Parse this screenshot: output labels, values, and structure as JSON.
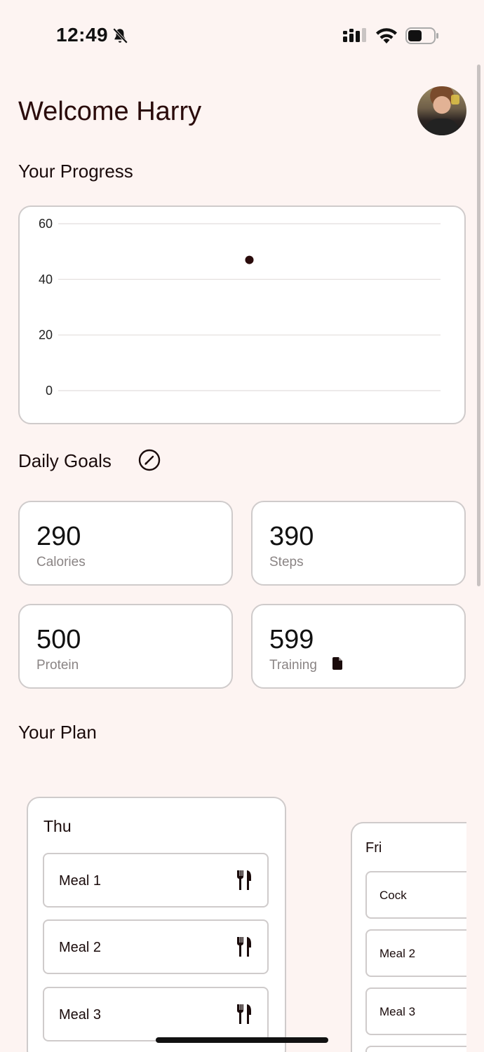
{
  "status_bar": {
    "time": "12:49"
  },
  "header": {
    "welcome": "Welcome Harry"
  },
  "progress": {
    "title": "Your Progress"
  },
  "chart_data": {
    "type": "scatter",
    "y_ticks": [
      "60",
      "40",
      "20",
      "0"
    ],
    "ylim": [
      0,
      60
    ],
    "grid": true,
    "series": [
      {
        "points": [
          {
            "x": 0.5,
            "y": 47
          }
        ]
      }
    ]
  },
  "daily_goals": {
    "title": "Daily Goals",
    "items": [
      {
        "value": "290",
        "label": "Calories"
      },
      {
        "value": "390",
        "label": "Steps"
      },
      {
        "value": "500",
        "label": "Protein"
      },
      {
        "value": "599",
        "label": "Training"
      }
    ]
  },
  "plan": {
    "title": "Your Plan",
    "days": [
      {
        "day": "Thu",
        "meals": [
          "Meal 1",
          "Meal 2",
          "Meal 3"
        ]
      },
      {
        "day": "Fri",
        "meals": [
          "Cock",
          "Meal 2",
          "Meal 3"
        ]
      }
    ]
  },
  "colors": {
    "background": "#fdf4f2",
    "card_border": "#cfcbcb",
    "accent": "#2a0b0b"
  },
  "icons": [
    "bell-off-icon",
    "signal-icon",
    "wifi-icon",
    "battery-icon",
    "edit-icon",
    "document-icon",
    "fork-knife-icon"
  ]
}
